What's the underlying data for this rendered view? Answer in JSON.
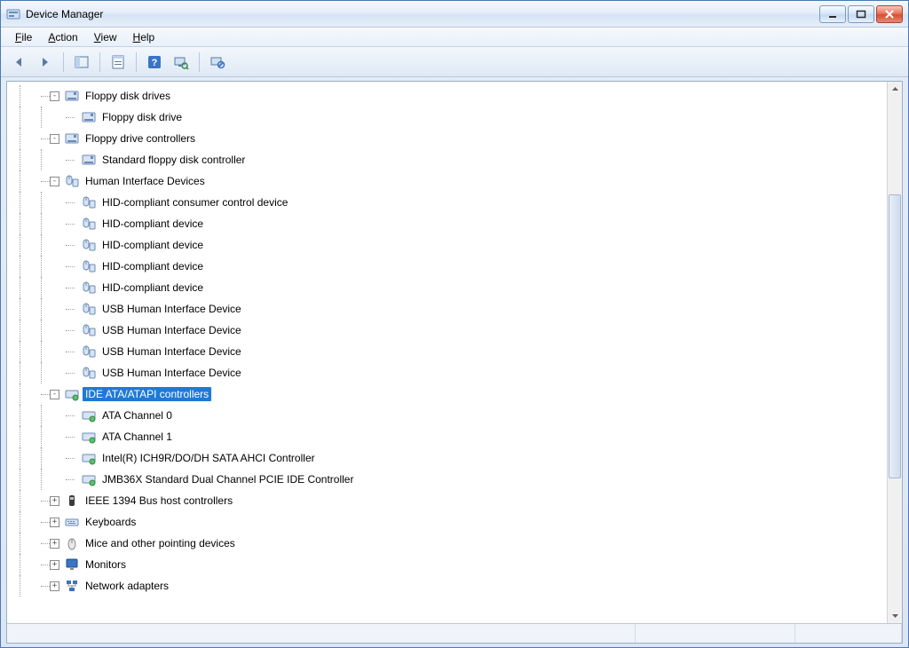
{
  "window": {
    "title": "Device Manager"
  },
  "menus": {
    "file": "File",
    "action": "Action",
    "view": "View",
    "help": "Help"
  },
  "toolbar": {
    "back": "Back",
    "forward": "Forward",
    "show_hide": "Show/Hide Console Tree",
    "properties": "Properties",
    "help": "Help",
    "scan": "Scan for hardware changes",
    "uninstall": "Uninstall"
  },
  "tree": [
    {
      "label": "Floppy disk drives",
      "level": 1,
      "expander": "-",
      "icon": "floppy-drive",
      "selected": false,
      "children": [
        {
          "label": "Floppy disk drive",
          "level": 2,
          "expander": null,
          "icon": "floppy-drive",
          "selected": false
        }
      ]
    },
    {
      "label": "Floppy drive controllers",
      "level": 1,
      "expander": "-",
      "icon": "floppy-controller",
      "selected": false,
      "children": [
        {
          "label": "Standard floppy disk controller",
          "level": 2,
          "expander": null,
          "icon": "floppy-controller",
          "selected": false
        }
      ]
    },
    {
      "label": "Human Interface Devices",
      "level": 1,
      "expander": "-",
      "icon": "hid",
      "selected": false,
      "children": [
        {
          "label": "HID-compliant consumer control device",
          "level": 2,
          "expander": null,
          "icon": "hid",
          "selected": false
        },
        {
          "label": "HID-compliant device",
          "level": 2,
          "expander": null,
          "icon": "hid",
          "selected": false
        },
        {
          "label": "HID-compliant device",
          "level": 2,
          "expander": null,
          "icon": "hid",
          "selected": false
        },
        {
          "label": "HID-compliant device",
          "level": 2,
          "expander": null,
          "icon": "hid",
          "selected": false
        },
        {
          "label": "HID-compliant device",
          "level": 2,
          "expander": null,
          "icon": "hid",
          "selected": false
        },
        {
          "label": "USB Human Interface Device",
          "level": 2,
          "expander": null,
          "icon": "hid",
          "selected": false
        },
        {
          "label": "USB Human Interface Device",
          "level": 2,
          "expander": null,
          "icon": "hid",
          "selected": false
        },
        {
          "label": "USB Human Interface Device",
          "level": 2,
          "expander": null,
          "icon": "hid",
          "selected": false
        },
        {
          "label": "USB Human Interface Device",
          "level": 2,
          "expander": null,
          "icon": "hid",
          "selected": false
        }
      ]
    },
    {
      "label": "IDE ATA/ATAPI controllers",
      "level": 1,
      "expander": "-",
      "icon": "ide",
      "selected": true,
      "children": [
        {
          "label": "ATA Channel 0",
          "level": 2,
          "expander": null,
          "icon": "ide",
          "selected": false
        },
        {
          "label": "ATA Channel 1",
          "level": 2,
          "expander": null,
          "icon": "ide",
          "selected": false
        },
        {
          "label": "Intel(R) ICH9R/DO/DH SATA AHCI Controller",
          "level": 2,
          "expander": null,
          "icon": "ide",
          "selected": false
        },
        {
          "label": "JMB36X Standard Dual Channel PCIE IDE Controller",
          "level": 2,
          "expander": null,
          "icon": "ide",
          "selected": false
        }
      ]
    },
    {
      "label": "IEEE 1394 Bus host controllers",
      "level": 1,
      "expander": "+",
      "icon": "firewire",
      "selected": false
    },
    {
      "label": "Keyboards",
      "level": 1,
      "expander": "+",
      "icon": "keyboard",
      "selected": false
    },
    {
      "label": "Mice and other pointing devices",
      "level": 1,
      "expander": "+",
      "icon": "mouse",
      "selected": false
    },
    {
      "label": "Monitors",
      "level": 1,
      "expander": "+",
      "icon": "monitor",
      "selected": false
    },
    {
      "label": "Network adapters",
      "level": 1,
      "expander": "+",
      "icon": "network",
      "selected": false
    }
  ],
  "icons": {
    "floppy-drive": "💾",
    "floppy-controller": "💾",
    "hid": "🖱",
    "ide": "💽",
    "firewire": "🔌",
    "keyboard": "⌨",
    "mouse": "🖱",
    "monitor": "🖥",
    "network": "🖧"
  }
}
